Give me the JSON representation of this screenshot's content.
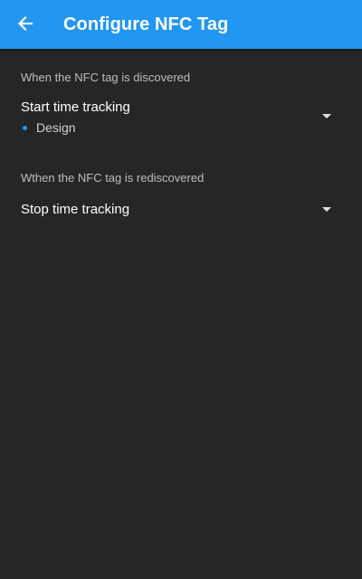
{
  "app_bar": {
    "title": "Configure NFC Tag",
    "back_icon": "arrow-left-icon",
    "color": "#2196f3"
  },
  "discovered": {
    "label": "When the NFC tag is discovered",
    "action": "Start time tracking",
    "project": "Design",
    "project_color": "#2196f3"
  },
  "rediscovered": {
    "label": "Wthen the NFC tag is rediscovered",
    "action": "Stop time tracking"
  },
  "background": "#262626"
}
